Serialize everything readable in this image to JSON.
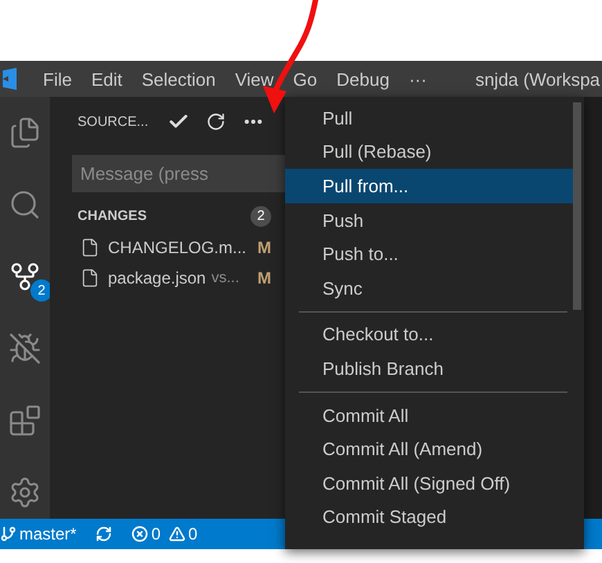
{
  "title_bar": {
    "menus": [
      "File",
      "Edit",
      "Selection",
      "View",
      "Go",
      "Debug",
      "···"
    ],
    "title": "snjda (Workspa"
  },
  "activity_bar": {
    "items": [
      {
        "kind": "files",
        "selected": false
      },
      {
        "kind": "search",
        "selected": false
      },
      {
        "kind": "scm",
        "selected": true,
        "badge": "2"
      },
      {
        "kind": "debug",
        "selected": false
      },
      {
        "kind": "extensions",
        "selected": false
      }
    ],
    "settings": {
      "kind": "settings"
    }
  },
  "sidebar": {
    "title": "SOURCE...",
    "message_placeholder": "Message (press",
    "section": {
      "title": "CHANGES",
      "count": "2"
    },
    "files": [
      {
        "name": "CHANGELOG.m...",
        "status": "M"
      },
      {
        "name": "package.json",
        "detail": "vs...",
        "status": "M"
      }
    ]
  },
  "menu": {
    "items": [
      {
        "kind": "item",
        "label": "Pull",
        "selected": false
      },
      {
        "kind": "item",
        "label": "Pull (Rebase)",
        "selected": false
      },
      {
        "kind": "item",
        "label": "Pull from...",
        "selected": true
      },
      {
        "kind": "item",
        "label": "Push",
        "selected": false
      },
      {
        "kind": "item",
        "label": "Push to...",
        "selected": false
      },
      {
        "kind": "item",
        "label": "Sync",
        "selected": false
      },
      {
        "kind": "separator"
      },
      {
        "kind": "item",
        "label": "Checkout to...",
        "selected": false
      },
      {
        "kind": "item",
        "label": "Publish Branch",
        "selected": false
      },
      {
        "kind": "separator"
      },
      {
        "kind": "item",
        "label": "Commit All",
        "selected": false
      },
      {
        "kind": "item",
        "label": "Commit All (Amend)",
        "selected": false
      },
      {
        "kind": "item",
        "label": "Commit All (Signed Off)",
        "selected": false
      },
      {
        "kind": "item",
        "label": "Commit Staged",
        "selected": false
      }
    ]
  },
  "status_bar": {
    "branch": "master*",
    "errors": "0",
    "warnings": "0"
  }
}
